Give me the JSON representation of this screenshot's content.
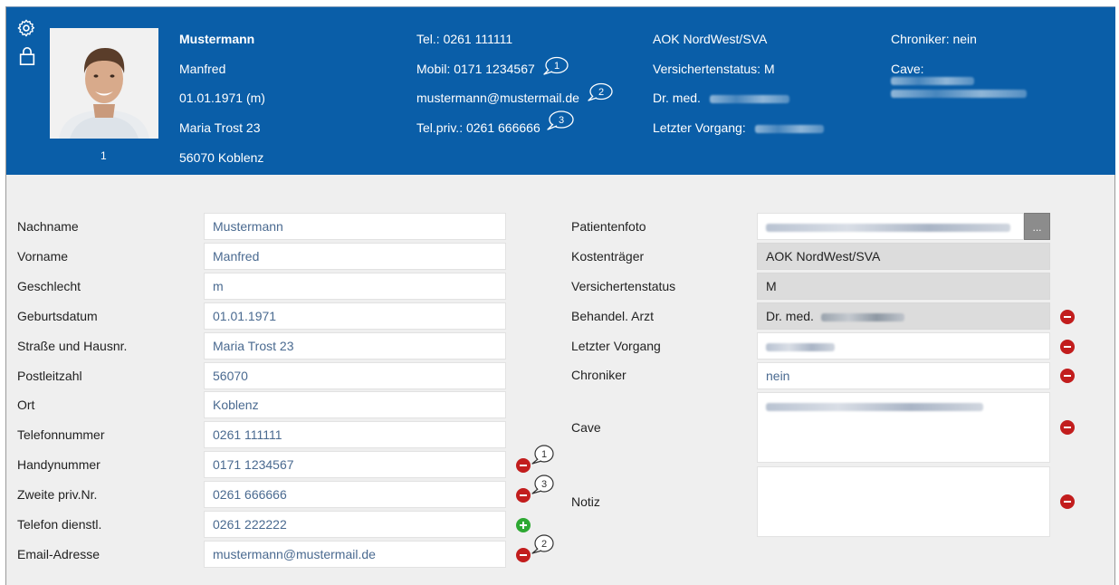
{
  "header": {
    "photo_index": "1",
    "patient": {
      "lastname": "Mustermann",
      "firstname": "Manfred",
      "birth": "01.01.1971 (m)",
      "street": "Maria Trost 23",
      "city": "56070 Koblenz"
    },
    "contact": {
      "phone": "Tel.: 0261 111111",
      "mobile": "Mobil: 0171 1234567",
      "email": "mustermann@mustermail.de",
      "phone_priv": "Tel.priv.: 0261 666666",
      "mobile_badge": "1",
      "email_badge": "2",
      "phone_priv_badge": "3"
    },
    "insurance": {
      "payer": "AOK NordWest/SVA",
      "status": "Versichertenstatus: M",
      "doctor": "Dr. med.",
      "last_visit": "Letzter Vorgang:"
    },
    "extra": {
      "chronic": "Chroniker: nein",
      "cave": "Cave:"
    }
  },
  "form_left": {
    "fields": [
      {
        "label": "Nachname",
        "value": "Mustermann"
      },
      {
        "label": "Vorname",
        "value": "Manfred"
      },
      {
        "label": "Geschlecht",
        "value": "m"
      },
      {
        "label": "Geburtsdatum",
        "value": "01.01.1971"
      },
      {
        "label": "Straße und Hausnr.",
        "value": "Maria Trost 23"
      },
      {
        "label": "Postleitzahl",
        "value": "56070"
      },
      {
        "label": "Ort",
        "value": "Koblenz"
      },
      {
        "label": "Telefonnummer",
        "value": "0261 111111"
      },
      {
        "label": "Handynummer",
        "value": "0171 1234567",
        "badge": "1"
      },
      {
        "label": "Zweite priv.Nr.",
        "value": "0261 666666",
        "badge": "3"
      },
      {
        "label": "Telefon dienstl.",
        "value": "0261 222222"
      },
      {
        "label": "Email-Adresse",
        "value": "mustermann@mustermail.de",
        "badge": "2"
      }
    ]
  },
  "form_right": {
    "photo_label": "Patientenfoto",
    "browse_label": "...",
    "payer_label": "Kostenträger",
    "payer_value": "AOK NordWest/SVA",
    "status_label": "Versichertenstatus",
    "status_value": "M",
    "doctor_label": "Behandel. Arzt",
    "doctor_value": "Dr. med.",
    "last_visit_label": "Letzter Vorgang",
    "chronic_label": "Chroniker",
    "chronic_value": "nein",
    "cave_label": "Cave",
    "note_label": "Notiz"
  },
  "colors": {
    "header_bg": "#0a5ea8",
    "remove": "#c21d1d",
    "add": "#2da832"
  },
  "icons": [
    "gear-icon",
    "lock-icon",
    "remove-icon",
    "add-icon",
    "speech-bubble-icon",
    "browse-icon"
  ]
}
